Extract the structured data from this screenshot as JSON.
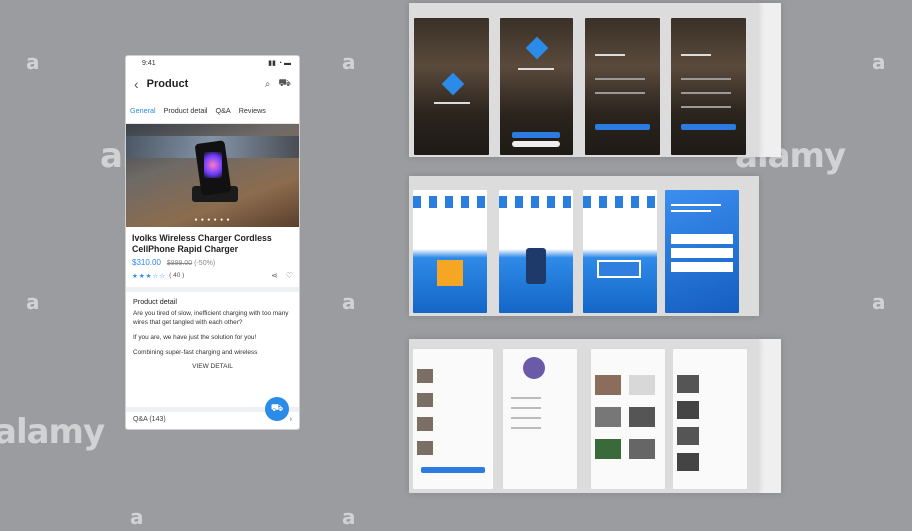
{
  "watermarks": {
    "a": "a",
    "alamy": "alamy"
  },
  "phone": {
    "status": {
      "time": "9:41",
      "icons": "▮▮ ◔ ▬"
    },
    "nav": {
      "back": "‹",
      "title": "Product",
      "search": "⌕",
      "cart": "⛟"
    },
    "tabs": [
      "General",
      "Product detail",
      "Q&A",
      "Reviews"
    ],
    "image_dots": "● ● ● ● ● ●",
    "product": {
      "name": "Ivolks Wireless Charger Cordless CellPhone Rapid Charger",
      "price": "$310.00",
      "old_price": "$899.00",
      "discount": "(-50%)",
      "stars": "★★★☆☆",
      "rating_count": "( 40 )",
      "share_icon": "⋖",
      "heart_icon": "♡"
    },
    "detail": {
      "heading": "Product detail",
      "p1": "Are you tired of slow, inefficient charging with too many wires that get tangled with each other?",
      "p2": "If you are, we have just the solution for you!",
      "p3": "Combining super-fast charging and wireless",
      "view_detail": "VIEW DETAIL"
    },
    "qa": {
      "label": "Q&A (143)",
      "chevron": "›"
    },
    "fab_icon": "⛟"
  }
}
